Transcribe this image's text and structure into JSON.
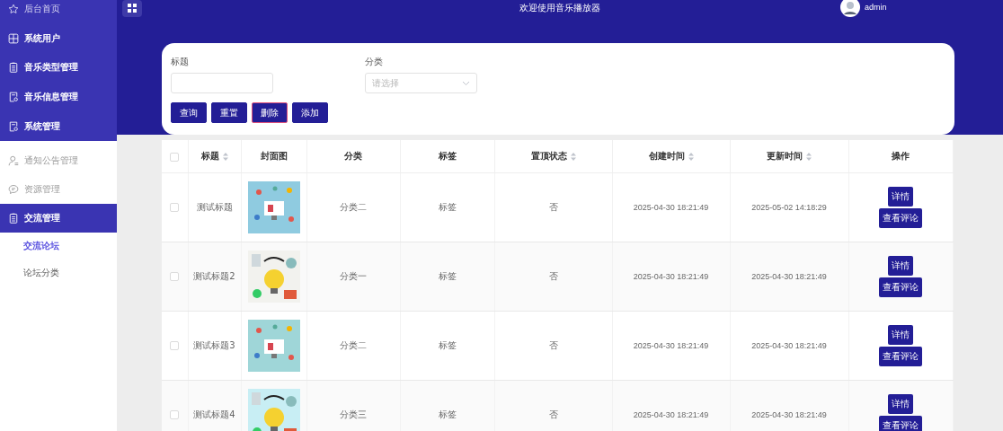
{
  "header": {
    "title": "欢迎使用音乐播放器",
    "user": "admin"
  },
  "sidebar": {
    "top_items": [
      {
        "label": "后台首页"
      },
      {
        "label": "系统用户"
      },
      {
        "label": "音乐类型管理"
      },
      {
        "label": "音乐信息管理"
      },
      {
        "label": "系统管理"
      }
    ],
    "items": [
      {
        "label": "通知公告管理",
        "selected": false
      },
      {
        "label": "资源管理",
        "selected": false
      },
      {
        "label": "交流管理",
        "selected": true,
        "children": [
          {
            "label": "交流论坛",
            "selected": true
          },
          {
            "label": "论坛分类",
            "selected": false
          }
        ]
      }
    ]
  },
  "filter": {
    "fields": [
      {
        "kind": "input",
        "label": "标题"
      },
      {
        "kind": "select",
        "label": "分类",
        "placeholder": "请选择"
      }
    ],
    "buttons": [
      {
        "label": "查询",
        "focused": false
      },
      {
        "label": "重置",
        "focused": false
      },
      {
        "label": "删除",
        "focused": true
      },
      {
        "label": "添加",
        "focused": false
      }
    ]
  },
  "table": {
    "all_checked": false,
    "columns": [
      {
        "label": "标题",
        "sortable": true
      },
      {
        "label": "封面图",
        "sortable": false
      },
      {
        "label": "分类",
        "sortable": false
      },
      {
        "label": "标签",
        "sortable": false
      },
      {
        "label": "置顶状态",
        "sortable": true
      },
      {
        "label": "创建时间",
        "sortable": true
      },
      {
        "label": "更新时间",
        "sortable": true
      },
      {
        "label": "操作",
        "sortable": false
      }
    ],
    "rows": [
      {
        "checked": false,
        "title": "测试标题",
        "category": "分类二",
        "tag": "标签",
        "pinned": "否",
        "created": "2025-04-30 18:21:49",
        "updated": "2025-05-02 14:18:29",
        "actions": [
          "详情",
          "查看评论"
        ]
      },
      {
        "checked": false,
        "title": "测试标题2",
        "category": "分类一",
        "tag": "标签",
        "pinned": "否",
        "created": "2025-04-30 18:21:49",
        "updated": "2025-04-30 18:21:49",
        "actions": [
          "详情",
          "查看评论"
        ]
      },
      {
        "checked": false,
        "title": "测试标题3",
        "category": "分类二",
        "tag": "标签",
        "pinned": "否",
        "created": "2025-04-30 18:21:49",
        "updated": "2025-04-30 18:21:49",
        "actions": [
          "详情",
          "查看评论"
        ]
      },
      {
        "checked": false,
        "title": "测试标题4",
        "category": "分类三",
        "tag": "标签",
        "pinned": "否",
        "created": "2025-04-30 18:21:49",
        "updated": "2025-04-30 18:21:49",
        "actions": [
          "详情",
          "查看评论"
        ]
      }
    ]
  }
}
